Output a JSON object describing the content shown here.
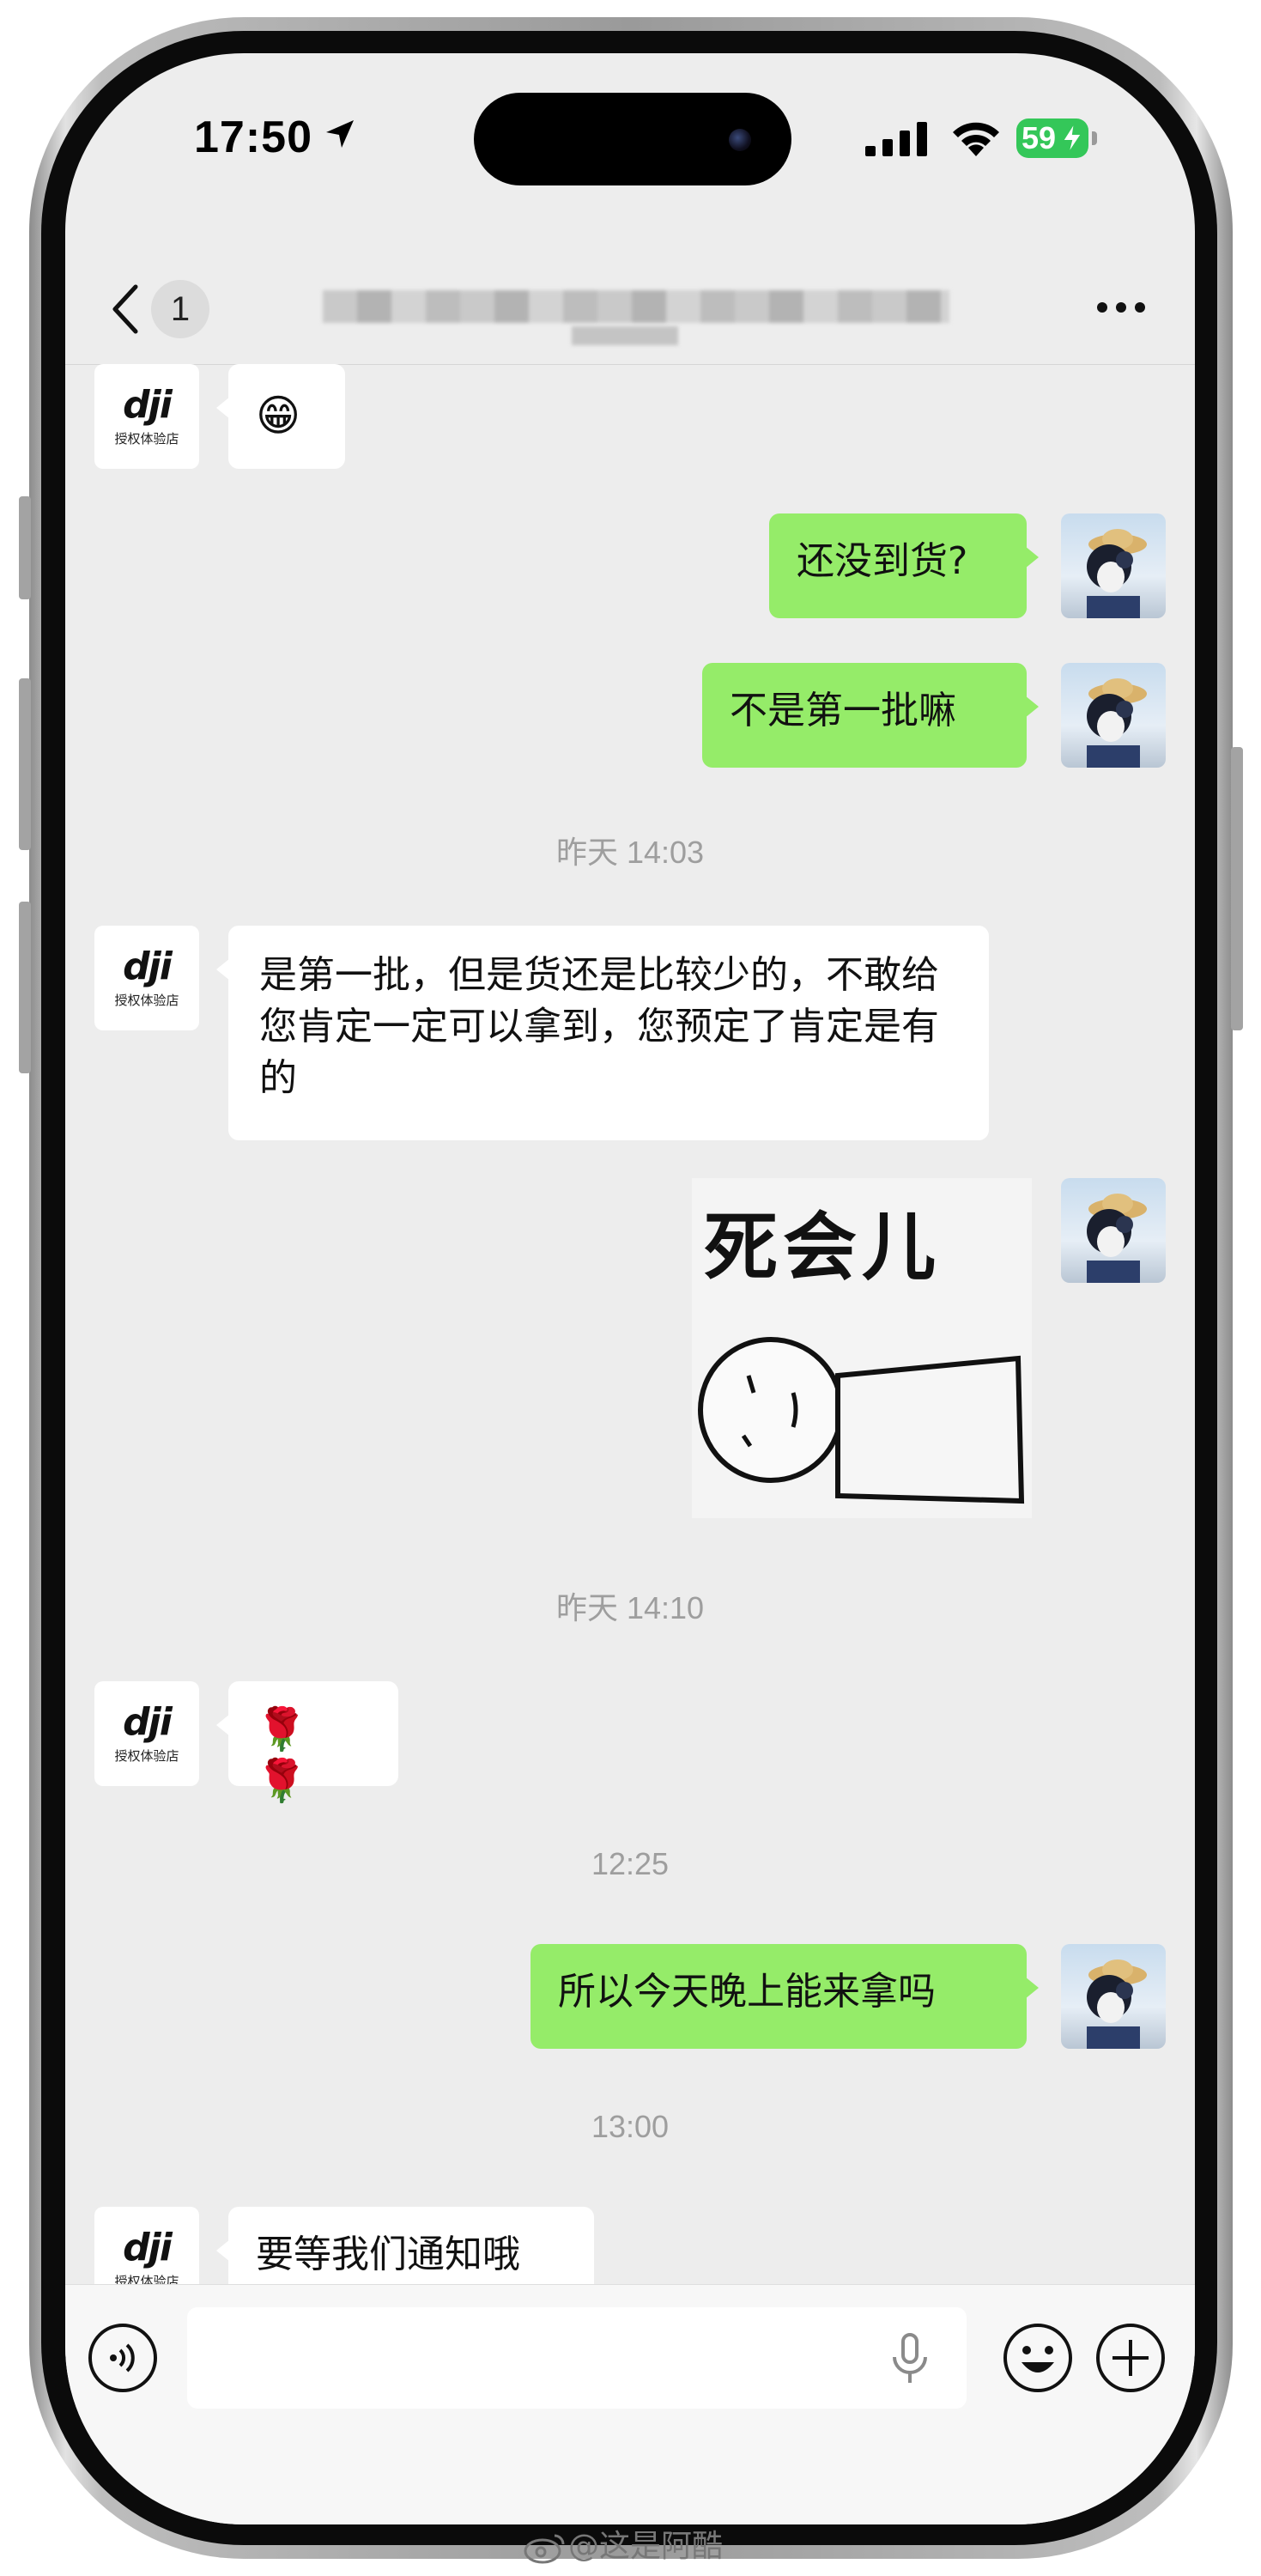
{
  "status_bar": {
    "time": "17:50",
    "battery": "59"
  },
  "nav": {
    "unread_count": "1"
  },
  "avatar_dji": {
    "logo": "dji",
    "subtitle": "授权体验店"
  },
  "messages": {
    "m1_emoji": "😁",
    "m2": "还没到货?",
    "m3": "不是第一批嘛",
    "ts1": "昨天 14:03",
    "m4": "是第一批，但是货还是比较少的，不敢给您肯定一定可以拿到，您预定了肯定是有的",
    "sticker_text": "死会儿",
    "ts2": "昨天 14:10",
    "m6_emoji": "🌹 🌹",
    "ts3": "12:25",
    "m7": "所以今天晚上能来拿吗",
    "ts4": "13:00",
    "m8": "要等我们通知哦"
  },
  "input": {
    "value": ""
  },
  "watermark": "@这是阿酷",
  "colors": {
    "chat_bg": "#ededed",
    "sent_bubble": "#95ec69",
    "received_bubble": "#ffffff",
    "battery": "#34c759"
  },
  "icons": [
    "location-arrow-icon",
    "signal-icon",
    "wifi-icon",
    "battery-icon",
    "back-chevron-icon",
    "more-icon",
    "voice-icon",
    "mic-icon",
    "emoji-icon",
    "plus-icon",
    "weibo-icon"
  ]
}
